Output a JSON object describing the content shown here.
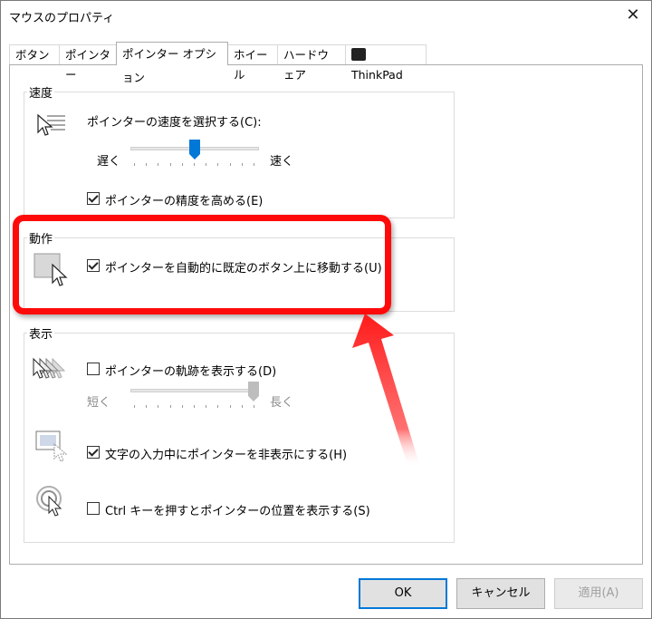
{
  "window": {
    "title": "マウスのプロパティ",
    "close_label": "✕"
  },
  "tabs": [
    {
      "label": "ボタン"
    },
    {
      "label": "ポインター"
    },
    {
      "label": "ポインター オプション"
    },
    {
      "label": "ホイール"
    },
    {
      "label": "ハードウェア"
    },
    {
      "label": "ThinkPad"
    }
  ],
  "speed": {
    "group_label": "速度",
    "select_label": "ポインターの速度を選択する(C):",
    "slow_label": "遅く",
    "fast_label": "速く",
    "slider_level": 0.5,
    "precision_label": "ポインターの精度を高める(E)",
    "precision_checked": true
  },
  "behavior": {
    "group_label": "動作",
    "snap_label": "ポインターを自動的に既定のボタン上に移動する(U)",
    "snap_checked": true
  },
  "display": {
    "group_label": "表示",
    "trails_label": "ポインターの軌跡を表示する(D)",
    "trails_checked": false,
    "short_label": "短く",
    "long_label": "長く",
    "trails_slider_level": 1.0,
    "hide_label": "文字の入力中にポインターを非表示にする(H)",
    "hide_checked": true,
    "ctrl_label": "Ctrl キーを押すとポインターの位置を表示する(S)",
    "ctrl_checked": false
  },
  "buttons": {
    "ok": "OK",
    "cancel": "キャンセル",
    "apply": "適用(A)"
  },
  "colors": {
    "highlight": "#ff0a0a",
    "accent": "#0078d7"
  }
}
